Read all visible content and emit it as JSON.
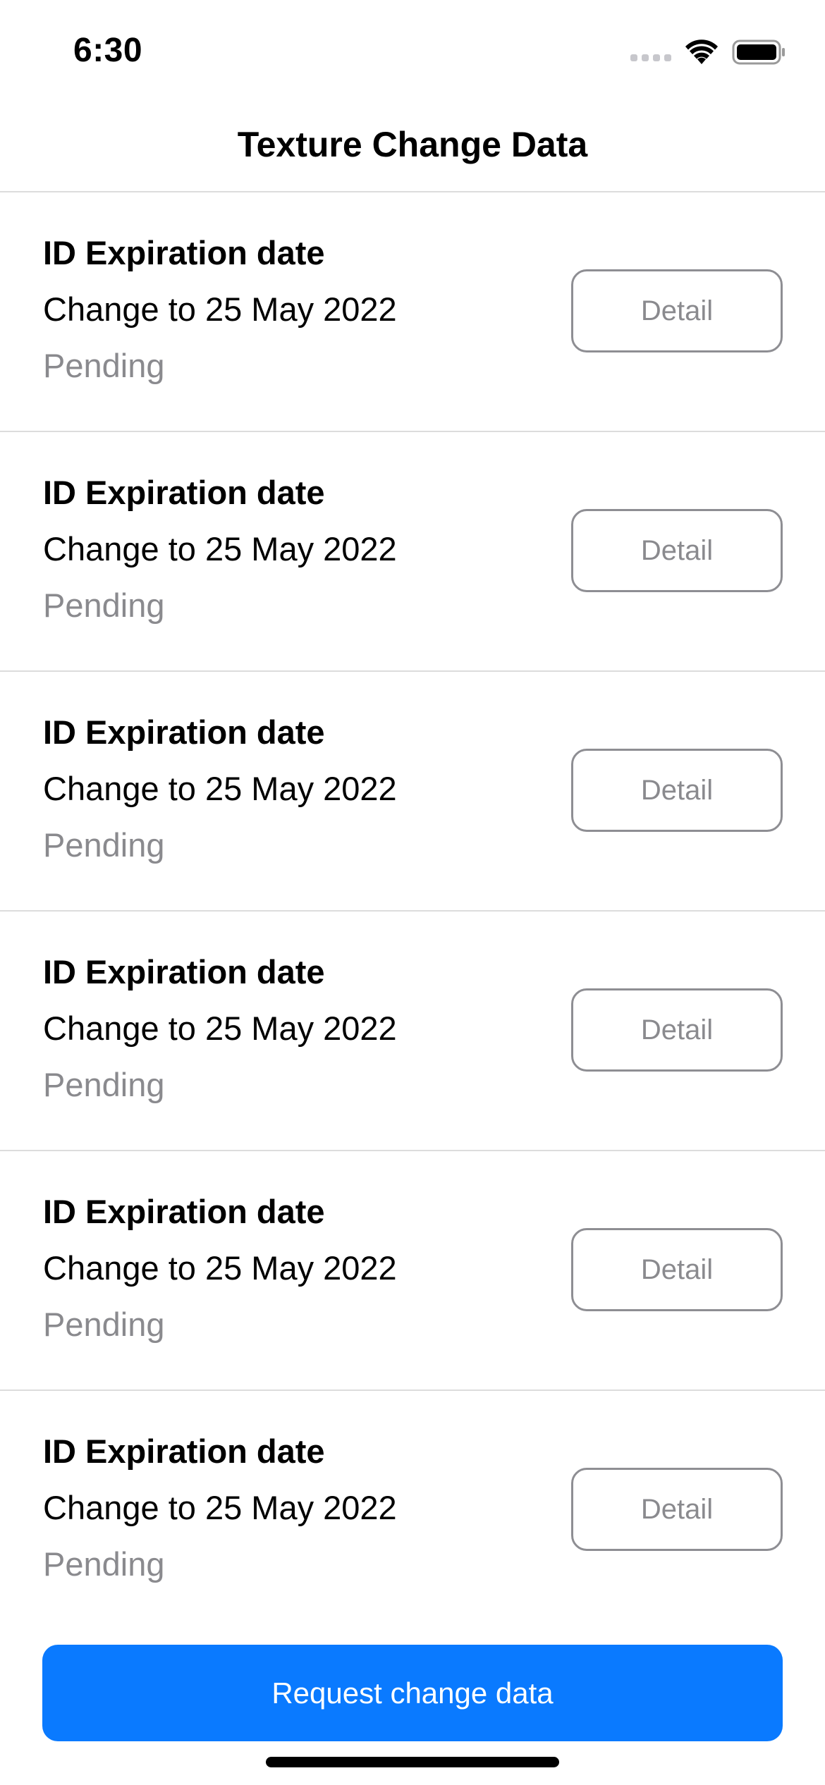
{
  "status_bar": {
    "time": "6:30",
    "icons": [
      "cellular-signal-icon",
      "wifi-icon",
      "battery-icon"
    ]
  },
  "nav": {
    "title": "Texture Change Data"
  },
  "items": [
    {
      "title": "ID Expiration date",
      "subtitle": "Change to 25 May 2022",
      "status": "Pending",
      "button_label": "Detail"
    },
    {
      "title": "ID Expiration date",
      "subtitle": "Change to 25 May 2022",
      "status": "Pending",
      "button_label": "Detail"
    },
    {
      "title": "ID Expiration date",
      "subtitle": "Change to 25 May 2022",
      "status": "Pending",
      "button_label": "Detail"
    },
    {
      "title": "ID Expiration date",
      "subtitle": "Change to 25 May 2022",
      "status": "Pending",
      "button_label": "Detail"
    },
    {
      "title": "ID Expiration date",
      "subtitle": "Change to 25 May 2022",
      "status": "Pending",
      "button_label": "Detail"
    },
    {
      "title": "ID Expiration date",
      "subtitle": "Change to 25 May 2022",
      "status": "Pending",
      "button_label": "Detail"
    }
  ],
  "primary_action": {
    "label": "Request change data"
  },
  "colors": {
    "accent": "#0a7aff",
    "secondary_text": "#8a8a8e",
    "divider": "#dcdcdc",
    "button_border": "#8e8e93"
  }
}
